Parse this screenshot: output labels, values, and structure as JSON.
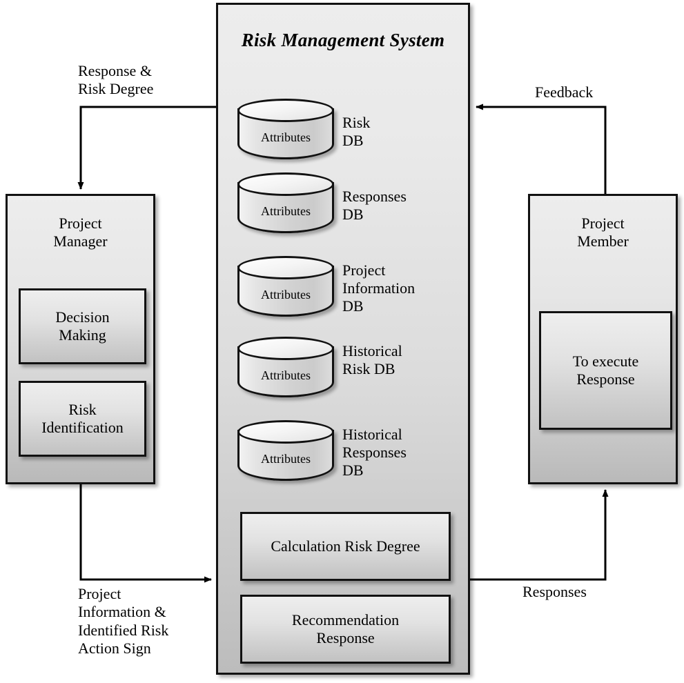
{
  "system": {
    "title": "Risk Management System",
    "databases": [
      {
        "label": "Risk DB",
        "attributes_label": "Attributes"
      },
      {
        "label": "Responses DB",
        "attributes_label": "Attributes"
      },
      {
        "label": "Project\nInformation DB",
        "attributes_label": "Attributes"
      },
      {
        "label": "Historical\nRisk DB",
        "attributes_label": "Attributes"
      },
      {
        "label": "Historical\nResponses DB",
        "attributes_label": "Attributes"
      }
    ],
    "processes": [
      {
        "label": "Calculation Risk Degree"
      },
      {
        "label": "Recommendation\nResponse"
      }
    ]
  },
  "actors": {
    "project_manager": {
      "title": "Project\nManager",
      "subprocesses": [
        {
          "label": "Decision\nMaking"
        },
        {
          "label": "Risk\nIdentification"
        }
      ]
    },
    "project_member": {
      "title": "Project\nMember",
      "subprocesses": [
        {
          "label": "To execute\nResponse"
        }
      ]
    }
  },
  "connectors": [
    {
      "name": "response-risk-degree",
      "label": "Response &\nRisk Degree",
      "from": "Risk Management System",
      "to": "Project Manager"
    },
    {
      "name": "project-information",
      "label": "Project\nInformation &\nIdentified Risk\nAction Sign",
      "from": "Project Manager",
      "to": "Risk Management System"
    },
    {
      "name": "feedback",
      "label": "Feedback",
      "from": "Project Member",
      "to": "Risk Management System"
    },
    {
      "name": "responses",
      "label": "Responses",
      "from": "Risk Management System",
      "to": "Project Member"
    }
  ],
  "colors": {
    "line": "#000000",
    "box_border": "#111111",
    "system_fill_top": "#ededed",
    "system_fill_bottom": "#bcbcbc",
    "canvas": "#ffffff"
  }
}
